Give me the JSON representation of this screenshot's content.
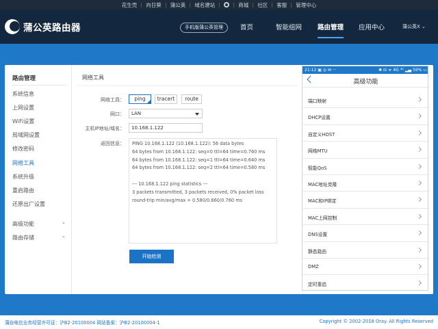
{
  "topbar": {
    "links": [
      "花生壳",
      "向日葵",
      "蒲公英",
      "域名建站",
      "商城",
      "社区",
      "客服",
      "管理中心"
    ]
  },
  "header": {
    "logo_text": "蒲公英路由器",
    "mgmt_button": "手机版蒲公英管理",
    "nav": [
      "首页",
      "智能组网",
      "路由管理",
      "应用中心"
    ],
    "active_nav": "路由管理",
    "user": "蒲公英X ⌄"
  },
  "sidebar": {
    "title": "路由管理",
    "items": [
      "系统信息",
      "上网设置",
      "WiFi设置",
      "局域网设置",
      "修改密码",
      "网络工具",
      "系统升级",
      "重启路由",
      "还原出厂设置"
    ],
    "active": "网络工具",
    "groups": [
      "高级功能",
      "路由存储"
    ]
  },
  "main": {
    "section_title": "网络工具",
    "labels": {
      "tool": "网络工具：",
      "port": "网口：",
      "target": "主机IP地址/域名：",
      "result": "返回信息："
    },
    "tools": [
      "ping",
      "tracert",
      "route"
    ],
    "selected_tool": "ping",
    "port_value": "LAN",
    "target_value": "10.168.1.122",
    "result_lines": [
      "PING 10.168.1.122 (10.168.1.122): 56 data bytes",
      "64 bytes from 10.168.1.122: seq=0 ttl=64 time=0.760 ms",
      "64 bytes from 10.168.1.122: seq=1 ttl=64 time=0.640 ms",
      "64 bytes from 10.168.1.122: seq=2 ttl=64 time=0.580 ms",
      "",
      "--- 10.168.1.122 ping statistics ---",
      "3 packets transmitted, 3 packets received, 0% packet loss",
      "round-trip min/avg/max = 0.580/0.660/0.760 ms"
    ],
    "start_button": "开始检测"
  },
  "phone": {
    "status_left": "21:12 ▣ ◎ ✉ ···",
    "status_right": "✱ ⊟ ᯤ 4G ⁴ᴳ ▂▄ 59% ▭",
    "title": "高级功能",
    "items": [
      "端口映射",
      "DHCP设置",
      "自定义HOST",
      "网络MTU",
      "智能QoS",
      "MAC地址克隆",
      "MAC和IP绑定",
      "MAC上网控制",
      "DNS设置",
      "静态路由",
      "DMZ",
      "定时重启"
    ]
  },
  "footer": {
    "left": "蒲自电信业务经营许可证：沪B2-20100004   网站备案：沪B2-20100004-1",
    "right": "Copyright © 2002-2018 Oray. All Rights Reserved"
  },
  "colors": {
    "header": "#13283e",
    "topbar": "#1e2b3a",
    "accent": "#1a73c7",
    "bg_blue": "#1f78c8"
  }
}
